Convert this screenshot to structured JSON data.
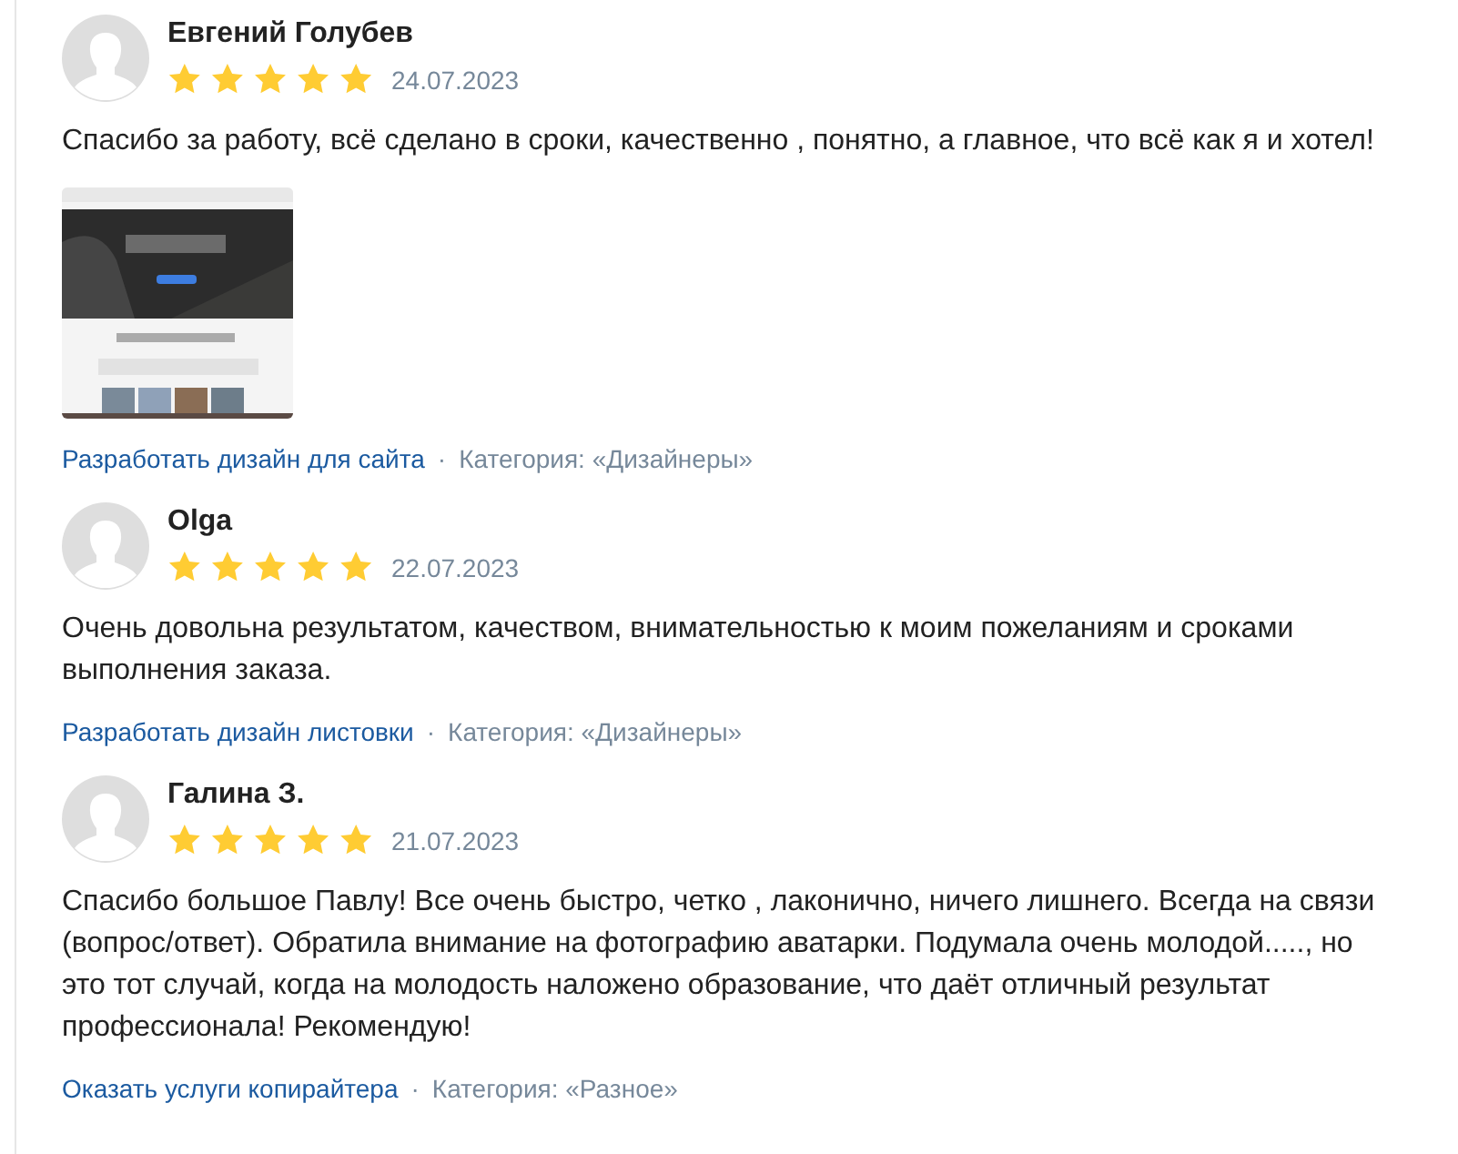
{
  "reviews": [
    {
      "author": "Евгений Голубев",
      "stars": 5,
      "date": "24.07.2023",
      "text": "Спасибо за работу, всё сделано в сроки, качественно , понятно, а главное, что всё как я и хотел!",
      "task": "Разработать дизайн для сайта",
      "separator": "·",
      "category": "Категория: «Дизайнеры»"
    },
    {
      "author": "Olga",
      "stars": 5,
      "date": "22.07.2023",
      "text": "Очень довольна результатом, качеством, внимательностью к моим пожеланиям и сроками выполнения заказа.",
      "task": "Разработать дизайн листовки",
      "separator": "·",
      "category": "Категория: «Дизайнеры»"
    },
    {
      "author": "Галина З.",
      "stars": 5,
      "date": "21.07.2023",
      "text": "Спасибо большое Павлу! Все очень быстро, четко , лаконично, ничего лишнего. Всегда на связи (вопрос/ответ). Обратила внимание на фотографию аватарки. Подумала очень молодой....., но это тот случай, когда на молодость наложено образование, что даёт отличный результат профессионала! Рекомендую!",
      "task": "Оказать услуги копирайтера",
      "separator": "·",
      "category": "Категория: «Разное»"
    }
  ]
}
